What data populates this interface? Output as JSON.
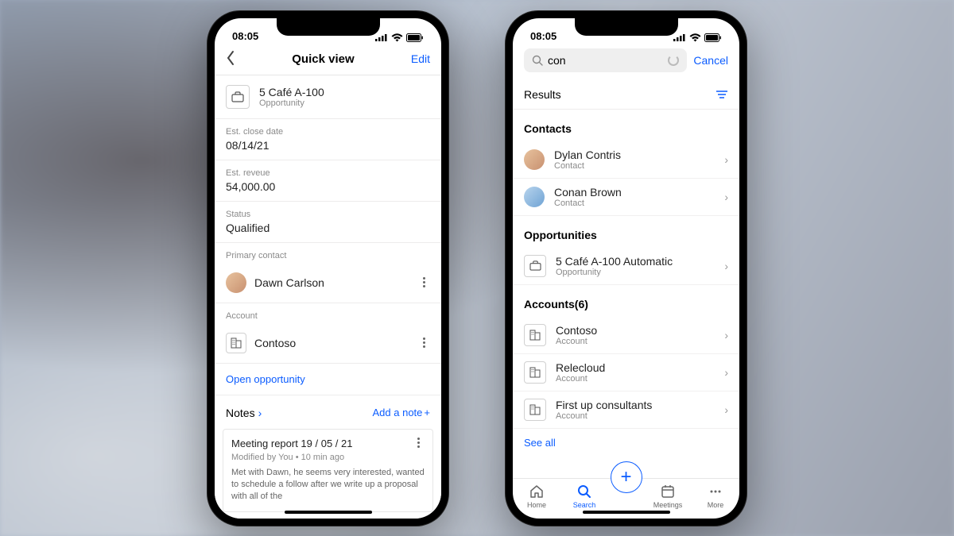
{
  "status": {
    "time": "08:05"
  },
  "phone1": {
    "header": {
      "title": "Quick view",
      "edit": "Edit"
    },
    "opportunity": {
      "title": "5 Café A-100",
      "subtitle": "Opportunity"
    },
    "fields": {
      "close_date_label": "Est. close date",
      "close_date_value": "08/14/21",
      "revenue_label": "Est. reveue",
      "revenue_value": "54,000.00",
      "status_label": "Status",
      "status_value": "Qualified",
      "contact_label": "Primary contact",
      "contact_value": "Dawn Carlson",
      "account_label": "Account",
      "account_value": "Contoso"
    },
    "open_link": "Open opportunity",
    "notes": {
      "header": "Notes",
      "add": "Add a note",
      "card": {
        "title": "Meeting report 19 / 05 / 21",
        "meta": "Modified by You • 10 min ago",
        "body": "Met with Dawn, he seems very interested, wanted to schedule a follow after we write up a proposal with all of the"
      }
    }
  },
  "phone2": {
    "search": {
      "query": "con",
      "cancel": "Cancel"
    },
    "results_label": "Results",
    "contacts": {
      "header": "Contacts",
      "items": [
        {
          "name": "Dylan Contris",
          "sub": "Contact"
        },
        {
          "name": "Conan Brown",
          "sub": "Contact"
        }
      ]
    },
    "opportunities": {
      "header": "Opportunities",
      "items": [
        {
          "name": "5 Café A-100 Automatic",
          "sub": "Opportunity"
        }
      ]
    },
    "accounts": {
      "header": "Accounts(6)",
      "items": [
        {
          "name": "Contoso",
          "sub": "Account"
        },
        {
          "name": "Relecloud",
          "sub": "Account"
        },
        {
          "name": "First up consultants",
          "sub": "Account"
        }
      ]
    },
    "see_all": "See all",
    "tabs": {
      "home": "Home",
      "search": "Search",
      "meetings": "Meetings",
      "more": "More"
    }
  }
}
